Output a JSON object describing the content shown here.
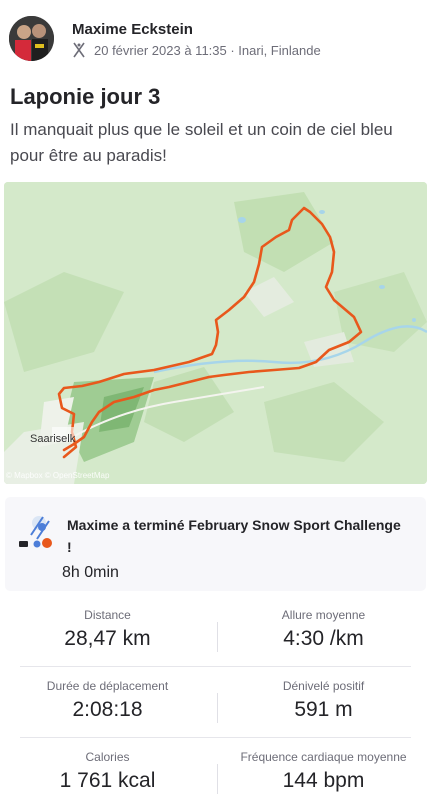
{
  "athlete": {
    "name": "Maxime Eckstein",
    "date_location": "20 février 2023 à 11:35 · Inari, Finlande",
    "sport_icon": "nordic-ski-icon"
  },
  "activity": {
    "title": "Laponie jour 3",
    "description": "Il manquait plus que le soleil et un coin de ciel bleu pour être au paradis!"
  },
  "map": {
    "place_label": "Saariselk",
    "attribution": "© Mapbox © OpenStreetMap",
    "route_color": "#e8581c"
  },
  "challenge": {
    "text": "Maxime a terminé February Snow Sport Challenge !",
    "duration": "8h 0min"
  },
  "stats": [
    {
      "label": "Distance",
      "value": "28,47 km"
    },
    {
      "label": "Allure moyenne",
      "value": "4:30 /km"
    },
    {
      "label": "Durée de déplacement",
      "value": "2:08:18"
    },
    {
      "label": "Dénivelé positif",
      "value": "591 m"
    },
    {
      "label": "Calories",
      "value": "1 761 kcal"
    },
    {
      "label": "Fréquence cardiaque moyenne",
      "value": "144 bpm"
    }
  ]
}
